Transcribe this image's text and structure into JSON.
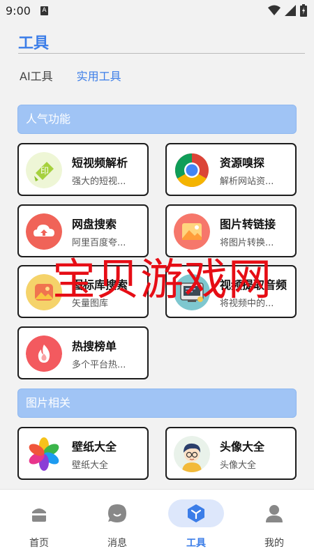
{
  "status": {
    "time": "9:00",
    "a_glyph": "A"
  },
  "header": {
    "title": "工具"
  },
  "tabs": [
    {
      "label": "AI工具",
      "active": false
    },
    {
      "label": "实用工具",
      "active": true
    }
  ],
  "sections": [
    {
      "title": "人气功能",
      "cards": [
        {
          "title": "短视频解析",
          "subtitle": "强大的短视...",
          "icon": "video-parse-icon"
        },
        {
          "title": "资源嗅探",
          "subtitle": "解析网站资...",
          "icon": "chrome-icon"
        },
        {
          "title": "网盘搜索",
          "subtitle": "阿里百度夸...",
          "icon": "cloud-upload-icon"
        },
        {
          "title": "图片转链接",
          "subtitle": "将图片转换...",
          "icon": "image-link-icon"
        },
        {
          "title": "图标库搜索",
          "subtitle": "矢量图库",
          "icon": "image-gallery-icon"
        },
        {
          "title": "视频提取音频",
          "subtitle": "将视频中的...",
          "icon": "audio-extract-icon"
        },
        {
          "title": "热搜榜单",
          "subtitle": "多个平台热...",
          "icon": "flame-icon"
        }
      ]
    },
    {
      "title": "图片相关",
      "cards": [
        {
          "title": "壁纸大全",
          "subtitle": "壁纸大全",
          "icon": "pinwheel-icon"
        },
        {
          "title": "头像大全",
          "subtitle": "头像大全",
          "icon": "avatar-boy-icon"
        }
      ]
    }
  ],
  "watermark": "宝贝游戏网",
  "nav": [
    {
      "label": "首页",
      "icon": "home-icon",
      "active": false
    },
    {
      "label": "消息",
      "icon": "message-icon",
      "active": false
    },
    {
      "label": "工具",
      "icon": "tools-icon",
      "active": true
    },
    {
      "label": "我的",
      "icon": "profile-icon",
      "active": false
    }
  ],
  "colors": {
    "accent": "#3b7de8",
    "section_bg": "#a0c4f5",
    "watermark": "#e60d15"
  }
}
